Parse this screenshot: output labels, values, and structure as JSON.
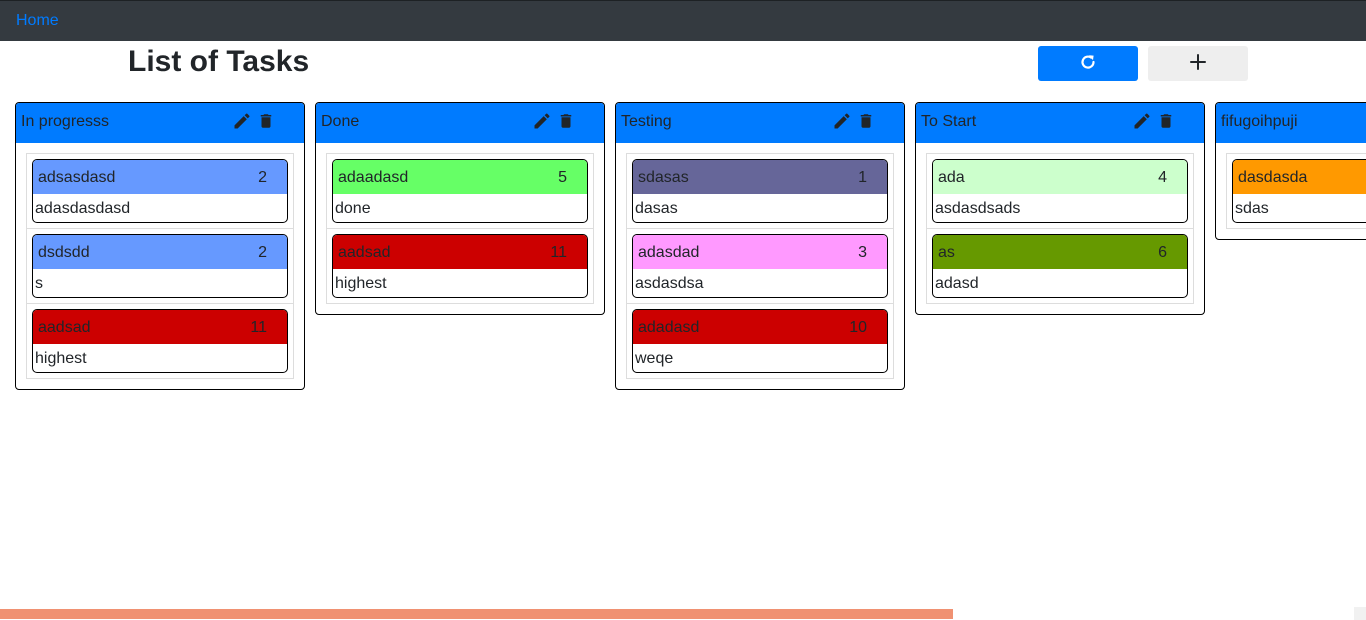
{
  "nav": {
    "home_label": "Home"
  },
  "page": {
    "title": "List of Tasks"
  },
  "toolbar": {
    "refresh_icon": "refresh-icon",
    "add_icon": "plus-icon"
  },
  "colors": {
    "header": "#007bff",
    "navbar": "#343a40",
    "progress": "#f09172"
  },
  "columns": [
    {
      "title": "In progresss",
      "cards": [
        {
          "name": "adsasdasd",
          "count": "2",
          "desc": "adasdasdasd",
          "color": "#6699ff"
        },
        {
          "name": "dsdsdd",
          "count": "2",
          "desc": "s",
          "color": "#6699ff"
        },
        {
          "name": "aadsad",
          "count": "11",
          "desc": "highest",
          "color": "#cc0000"
        }
      ]
    },
    {
      "title": "Done",
      "cards": [
        {
          "name": "adaadasd",
          "count": "5",
          "desc": "done",
          "color": "#66ff66"
        },
        {
          "name": "aadsad",
          "count": "11",
          "desc": "highest",
          "color": "#cc0000"
        }
      ]
    },
    {
      "title": "Testing",
      "cards": [
        {
          "name": "sdasas",
          "count": "1",
          "desc": "dasas",
          "color": "#666699"
        },
        {
          "name": "adasdad",
          "count": "3",
          "desc": "asdasdsa",
          "color": "#ff99ff"
        },
        {
          "name": "adadasd",
          "count": "10",
          "desc": "weqe",
          "color": "#cc0000"
        }
      ]
    },
    {
      "title": "To Start",
      "cards": [
        {
          "name": "ada",
          "count": "4",
          "desc": "asdasdsads",
          "color": "#ccffcc"
        },
        {
          "name": "as",
          "count": "6",
          "desc": "adasd",
          "color": "#669900"
        }
      ]
    },
    {
      "title": "fifugoihpuji",
      "cards": [
        {
          "name": "dasdasda",
          "count": "",
          "desc": "sdas",
          "color": "#ff9900"
        }
      ]
    }
  ]
}
